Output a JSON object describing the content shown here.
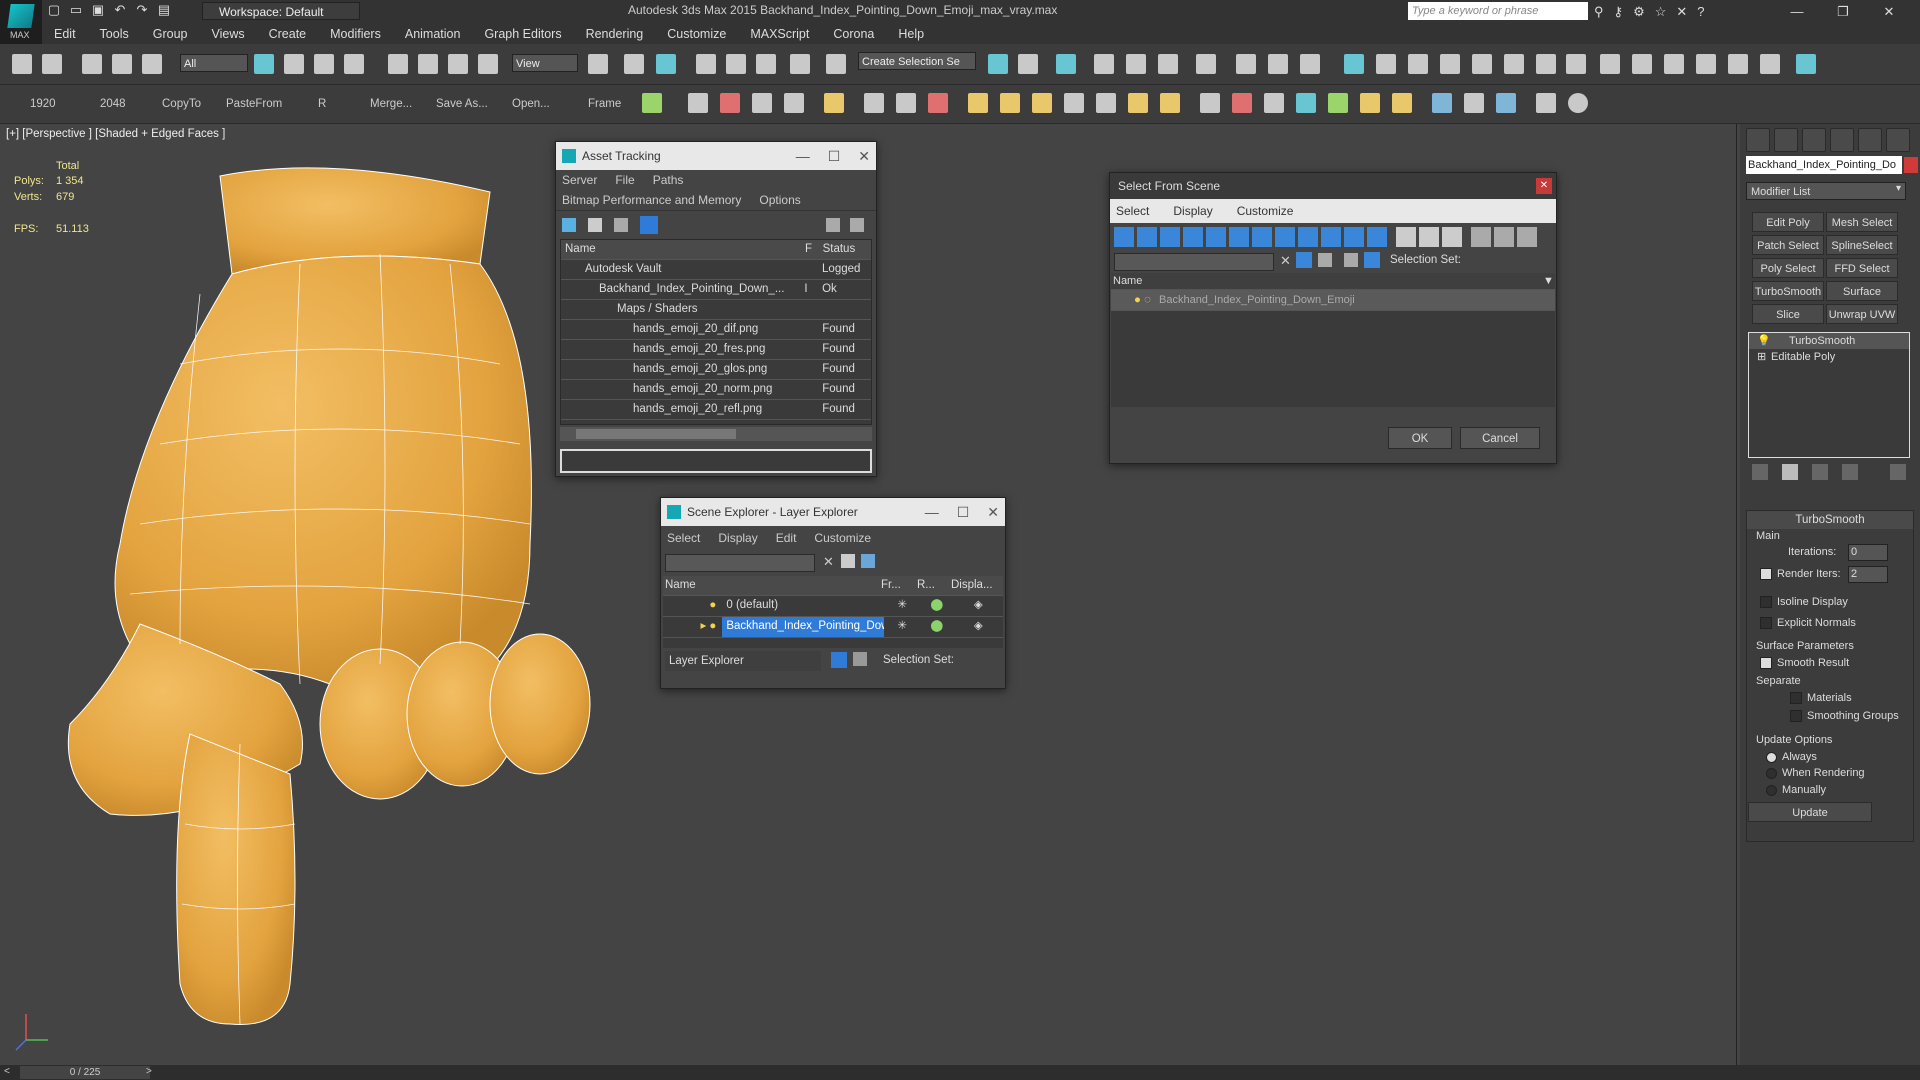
{
  "app": {
    "title": "Autodesk 3ds Max  2015    Backhand_Index_Pointing_Down_Emoji_max_vray.max",
    "workspace": "Workspace: Default",
    "search_placeholder": "Type a keyword or phrase",
    "logo_label": "MAX"
  },
  "menu": [
    "Edit",
    "Tools",
    "Group",
    "Views",
    "Create",
    "Modifiers",
    "Animation",
    "Graph Editors",
    "Rendering",
    "Customize",
    "MAXScript",
    "Corona",
    "Help"
  ],
  "toolbar": {
    "filter": "All",
    "refcoord": "View",
    "selection_set": "Create Selection Se"
  },
  "toolbar2": {
    "labels": [
      "1920",
      "2048",
      "CopyTo",
      "PasteFrom",
      "R",
      "Merge...",
      "Save As...",
      "Open...",
      "Frame"
    ]
  },
  "viewport": {
    "label": "[+] [Perspective ] [Shaded + Edged Faces ]",
    "total_label": "Total",
    "polys_label": "Polys:",
    "polys": "1 354",
    "verts_label": "Verts:",
    "verts": "679",
    "fps_label": "FPS:",
    "fps": "51.113"
  },
  "asset_tracking": {
    "title": "Asset Tracking",
    "menu1": [
      "Server",
      "File",
      "Paths"
    ],
    "menu2": [
      "Bitmap Performance and Memory",
      "Options"
    ],
    "col_name": "Name",
    "col_f": "F",
    "col_status": "Status",
    "rows": [
      {
        "name": "Autodesk Vault",
        "f": "",
        "status": "Logged"
      },
      {
        "name": "Backhand_Index_Pointing_Down_...",
        "f": "I",
        "status": "Ok"
      },
      {
        "name": "Maps / Shaders",
        "f": "",
        "status": ""
      },
      {
        "name": "hands_emoji_20_dif.png",
        "f": "",
        "status": "Found"
      },
      {
        "name": "hands_emoji_20_fres.png",
        "f": "",
        "status": "Found"
      },
      {
        "name": "hands_emoji_20_glos.png",
        "f": "",
        "status": "Found"
      },
      {
        "name": "hands_emoji_20_norm.png",
        "f": "",
        "status": "Found"
      },
      {
        "name": "hands_emoji_20_refl.png",
        "f": "",
        "status": "Found"
      }
    ]
  },
  "scene_explorer": {
    "title": "Scene Explorer - Layer Explorer",
    "menu": [
      "Select",
      "Display",
      "Edit",
      "Customize"
    ],
    "cols": [
      "Name",
      "Fr...",
      "R...",
      "Displa..."
    ],
    "rows": [
      {
        "name": "0 (default)",
        "selected": false
      },
      {
        "name": "Backhand_Index_Pointing_Dow...",
        "selected": true
      }
    ],
    "layer_explorer": "Layer Explorer",
    "selection_set": "Selection Set:"
  },
  "select_from_scene": {
    "title": "Select From Scene",
    "tabs": [
      "Select",
      "Display",
      "Customize"
    ],
    "selection_set": "Selection Set:",
    "col_name": "Name",
    "item": "Backhand_Index_Pointing_Down_Emoji",
    "ok": "OK",
    "cancel": "Cancel"
  },
  "command_panel": {
    "object_name": "Backhand_Index_Pointing_Do",
    "modifier_list": "Modifier List",
    "buttons": [
      "Edit Poly",
      "Mesh Select",
      "Patch Select",
      "SplineSelect",
      "Poly Select",
      "FFD Select",
      "TurboSmooth",
      "Surface Select",
      "Slice",
      "Unwrap UVW"
    ],
    "stack": [
      "TurboSmooth",
      "Editable Poly"
    ],
    "rollout": "TurboSmooth",
    "main": "Main",
    "iterations_label": "Iterations:",
    "iterations": "0",
    "render_iters_label": "Render Iters:",
    "render_iters": "2",
    "isoline": "Isoline Display",
    "explicit": "Explicit Normals",
    "surface_params": "Surface Parameters",
    "smooth_result": "Smooth Result",
    "separate": "Separate",
    "materials": "Materials",
    "smoothing_groups": "Smoothing Groups",
    "update_options": "Update Options",
    "always": "Always",
    "when_rendering": "When Rendering",
    "manually": "Manually",
    "update": "Update"
  },
  "timeline": {
    "frame": "0 / 225"
  }
}
